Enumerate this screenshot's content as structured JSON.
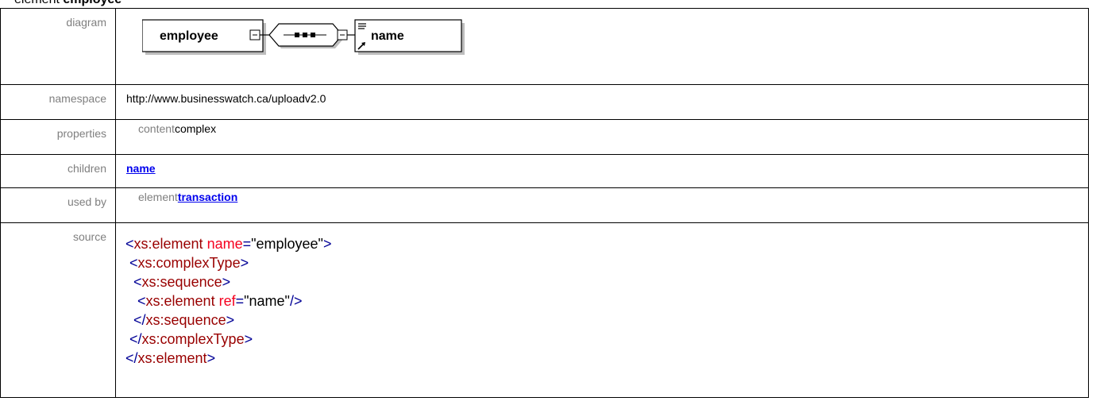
{
  "heading": {
    "prefix": "element",
    "name": "employee"
  },
  "rows": {
    "diagram": {
      "label": "diagram",
      "element_box": "employee",
      "child_box": "name"
    },
    "namespace": {
      "label": "namespace",
      "value": "http://www.businesswatch.ca/uploadv2.0"
    },
    "properties": {
      "label": "properties",
      "key": "content",
      "value": "complex"
    },
    "children": {
      "label": "children",
      "link": "name"
    },
    "used_by": {
      "label": "used by",
      "key": "element",
      "link": "transaction"
    },
    "source": {
      "label": "source",
      "lines": [
        {
          "indent": "",
          "open": "<",
          "tag": "xs:element",
          "attr": "name",
          "eq": "=",
          "val": "\"employee\"",
          "close": ">"
        },
        {
          "indent": " ",
          "open": "<",
          "tag": "xs:complexType",
          "attr": "",
          "eq": "",
          "val": "",
          "close": ">"
        },
        {
          "indent": "  ",
          "open": "<",
          "tag": "xs:sequence",
          "attr": "",
          "eq": "",
          "val": "",
          "close": ">"
        },
        {
          "indent": "   ",
          "open": "<",
          "tag": "xs:element",
          "attr": "ref",
          "eq": "=",
          "val": "\"name\"",
          "close": "/>"
        },
        {
          "indent": "  ",
          "open": "</",
          "tag": "xs:sequence",
          "attr": "",
          "eq": "",
          "val": "",
          "close": ">"
        },
        {
          "indent": " ",
          "open": "</",
          "tag": "xs:complexType",
          "attr": "",
          "eq": "",
          "val": "",
          "close": ">"
        },
        {
          "indent": "",
          "open": "</",
          "tag": "xs:element",
          "attr": "",
          "eq": "",
          "val": "",
          "close": ">"
        }
      ]
    }
  },
  "colors": {
    "label_gray": "#7f7f7f",
    "link_blue": "#0000ee",
    "xml_bracket": "#000096",
    "xml_tag": "#990000",
    "xml_attr": "#f5001f"
  }
}
